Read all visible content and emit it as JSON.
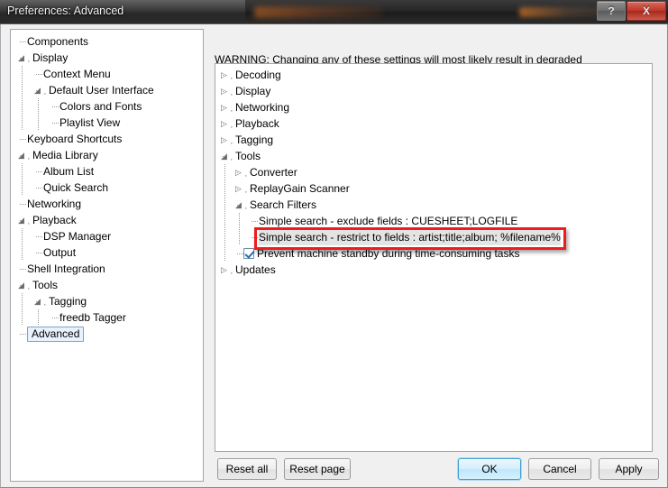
{
  "window": {
    "title": "Preferences: Advanced",
    "help_button": "?",
    "close_button": "X"
  },
  "sidebar": {
    "items": [
      {
        "label": "Components",
        "depth": 1,
        "twisty": "none",
        "selected": false
      },
      {
        "label": "Display",
        "depth": 1,
        "twisty": "expanded",
        "selected": false
      },
      {
        "label": "Context Menu",
        "depth": 2,
        "twisty": "none",
        "selected": false
      },
      {
        "label": "Default User Interface",
        "depth": 2,
        "twisty": "expanded",
        "selected": false
      },
      {
        "label": "Colors and Fonts",
        "depth": 3,
        "twisty": "none",
        "selected": false
      },
      {
        "label": "Playlist View",
        "depth": 3,
        "twisty": "none",
        "selected": false
      },
      {
        "label": "Keyboard Shortcuts",
        "depth": 1,
        "twisty": "none",
        "selected": false
      },
      {
        "label": "Media Library",
        "depth": 1,
        "twisty": "expanded",
        "selected": false
      },
      {
        "label": "Album List",
        "depth": 2,
        "twisty": "none",
        "selected": false
      },
      {
        "label": "Quick Search",
        "depth": 2,
        "twisty": "none",
        "selected": false
      },
      {
        "label": "Networking",
        "depth": 1,
        "twisty": "none",
        "selected": false
      },
      {
        "label": "Playback",
        "depth": 1,
        "twisty": "expanded",
        "selected": false
      },
      {
        "label": "DSP Manager",
        "depth": 2,
        "twisty": "none",
        "selected": false
      },
      {
        "label": "Output",
        "depth": 2,
        "twisty": "none",
        "selected": false
      },
      {
        "label": "Shell Integration",
        "depth": 1,
        "twisty": "none",
        "selected": false
      },
      {
        "label": "Tools",
        "depth": 1,
        "twisty": "expanded",
        "selected": false
      },
      {
        "label": "Tagging",
        "depth": 2,
        "twisty": "expanded",
        "selected": false
      },
      {
        "label": "freedb Tagger",
        "depth": 3,
        "twisty": "none",
        "selected": false
      },
      {
        "label": "Advanced",
        "depth": 1,
        "twisty": "none",
        "selected": true
      }
    ]
  },
  "main": {
    "warning": "WARNING: Changing any of these settings will most likely result in degraded performance or compatibility issues, or both. Change them at your own risk.",
    "tree": [
      {
        "label": "Decoding",
        "depth": 1,
        "twisty": "collapsed",
        "checkbox": "none",
        "highlighted": false
      },
      {
        "label": "Display",
        "depth": 1,
        "twisty": "collapsed",
        "checkbox": "none",
        "highlighted": false
      },
      {
        "label": "Networking",
        "depth": 1,
        "twisty": "collapsed",
        "checkbox": "none",
        "highlighted": false
      },
      {
        "label": "Playback",
        "depth": 1,
        "twisty": "collapsed",
        "checkbox": "none",
        "highlighted": false
      },
      {
        "label": "Tagging",
        "depth": 1,
        "twisty": "collapsed",
        "checkbox": "none",
        "highlighted": false
      },
      {
        "label": "Tools",
        "depth": 1,
        "twisty": "expanded",
        "checkbox": "none",
        "highlighted": false
      },
      {
        "label": "Converter",
        "depth": 2,
        "twisty": "collapsed",
        "checkbox": "none",
        "highlighted": false
      },
      {
        "label": "ReplayGain Scanner",
        "depth": 2,
        "twisty": "collapsed",
        "checkbox": "none",
        "highlighted": false
      },
      {
        "label": "Search Filters",
        "depth": 2,
        "twisty": "expanded",
        "checkbox": "none",
        "highlighted": false
      },
      {
        "label": "Simple search - exclude fields : CUESHEET;LOGFILE",
        "depth": 3,
        "twisty": "none",
        "checkbox": "none",
        "highlighted": false
      },
      {
        "label": "Simple search - restrict to fields : artist;title;album; %filename%",
        "depth": 3,
        "twisty": "none",
        "checkbox": "none",
        "highlighted": true
      },
      {
        "label": "Prevent machine standby during time-consuming tasks",
        "depth": 2,
        "twisty": "none",
        "checkbox": "checked",
        "highlighted": false
      },
      {
        "label": "Updates",
        "depth": 1,
        "twisty": "collapsed",
        "checkbox": "none",
        "highlighted": false
      }
    ],
    "callout": {
      "color": "#ee1c1c",
      "target_label": "Simple search - restrict to fields : artist;title;album; %filename%"
    }
  },
  "footer": {
    "reset_all": "Reset all",
    "reset_page": "Reset page",
    "ok": "OK",
    "cancel": "Cancel",
    "apply": "Apply"
  }
}
